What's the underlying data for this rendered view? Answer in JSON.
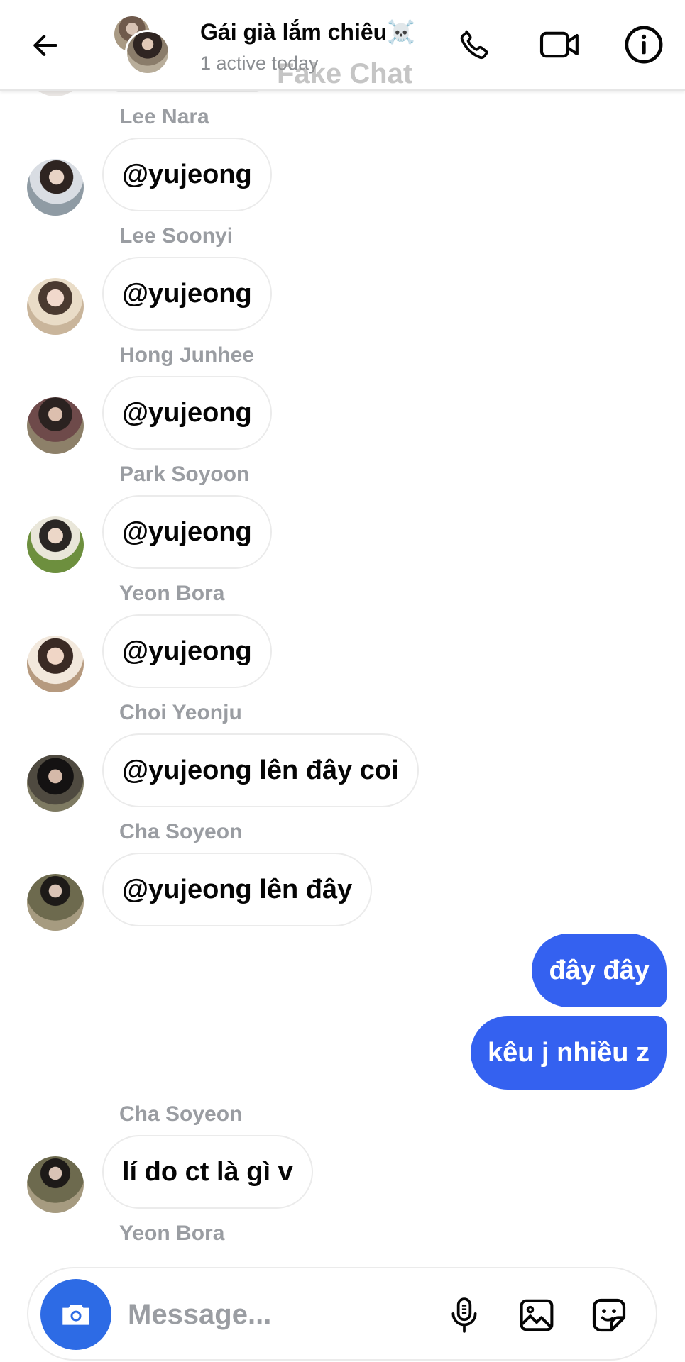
{
  "header": {
    "title": "Gái già lắm chiêu☠️",
    "subtitle": "1 active today",
    "watermark": "Fake Chat",
    "icons": {
      "back": "arrow-left-icon",
      "call": "phone-icon",
      "video": "video-camera-icon",
      "info": "info-icon"
    }
  },
  "messages": [
    {
      "sender": "Lee Nara",
      "text": "@yujeong"
    },
    {
      "sender": "Lee Soonyi",
      "text": "@yujeong"
    },
    {
      "sender": "Hong Junhee",
      "text": "@yujeong"
    },
    {
      "sender": "Park Soyoon",
      "text": "@yujeong"
    },
    {
      "sender": "Yeon Bora",
      "text": "@yujeong"
    },
    {
      "sender": "Choi Yeonju",
      "text": "@yujeong lên đây coi"
    },
    {
      "sender": "Cha Soyeon",
      "text": "@yujeong lên đây"
    },
    {
      "text": "đây đây"
    },
    {
      "text": "kêu j nhiều z"
    },
    {
      "sender": "Cha Soyeon",
      "text": "lí do ct là gì v"
    },
    {
      "sender": "Yeon Bora"
    }
  ],
  "composer": {
    "placeholder": "Message...",
    "icons": {
      "camera": "camera-icon",
      "mic": "microphone-icon",
      "image": "image-icon",
      "sticker": "sticker-icon"
    }
  },
  "colors": {
    "accent": "#3461f0",
    "camera_button": "#2d6be5",
    "sender_label": "#9a9da2"
  }
}
